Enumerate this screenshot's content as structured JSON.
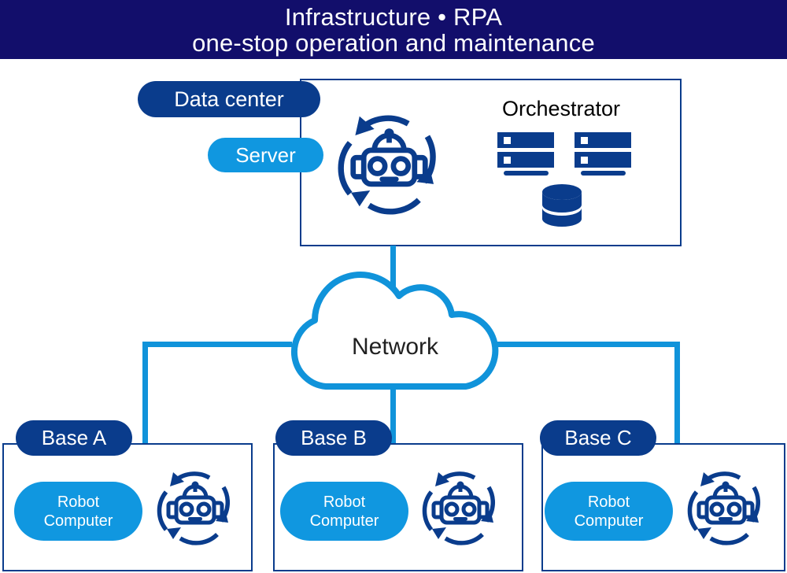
{
  "header": {
    "title_line1": "Infrastructure • RPA",
    "title_line2": "one-stop operation and maintenance",
    "background_color": "#120E6B",
    "text_color": "#FFFFFF"
  },
  "colors": {
    "navy": "#0A3C8C",
    "azure": "#1097E0",
    "cloud_blue": "#1093DA",
    "header_navy": "#120E6B",
    "label_black": "#000000",
    "network_text": "#212121"
  },
  "datacenter": {
    "pill_label": "Data center",
    "server_pill_label": "Server",
    "orchestrator_label": "Orchestrator",
    "robot_icon": "robot-cycle-icon",
    "server_stack_icon": "server-rack-icon",
    "database_icon": "database-cylinder-icon"
  },
  "network": {
    "label": "Network",
    "icon": "cloud-icon"
  },
  "bases": [
    {
      "pill_label": "Base A",
      "robot_pill_label": "Robot\nComputer",
      "robot_icon": "robot-cycle-icon"
    },
    {
      "pill_label": "Base B",
      "robot_pill_label": "Robot\nComputer",
      "robot_icon": "robot-cycle-icon"
    },
    {
      "pill_label": "Base C",
      "robot_pill_label": "Robot\nComputer",
      "robot_icon": "robot-cycle-icon"
    }
  ],
  "connectors": {
    "datacenter_to_cloud": "vertical-line",
    "cloud_to_base_a": "elbow-line-left",
    "cloud_to_base_b": "vertical-line",
    "cloud_to_base_c": "elbow-line-right"
  }
}
